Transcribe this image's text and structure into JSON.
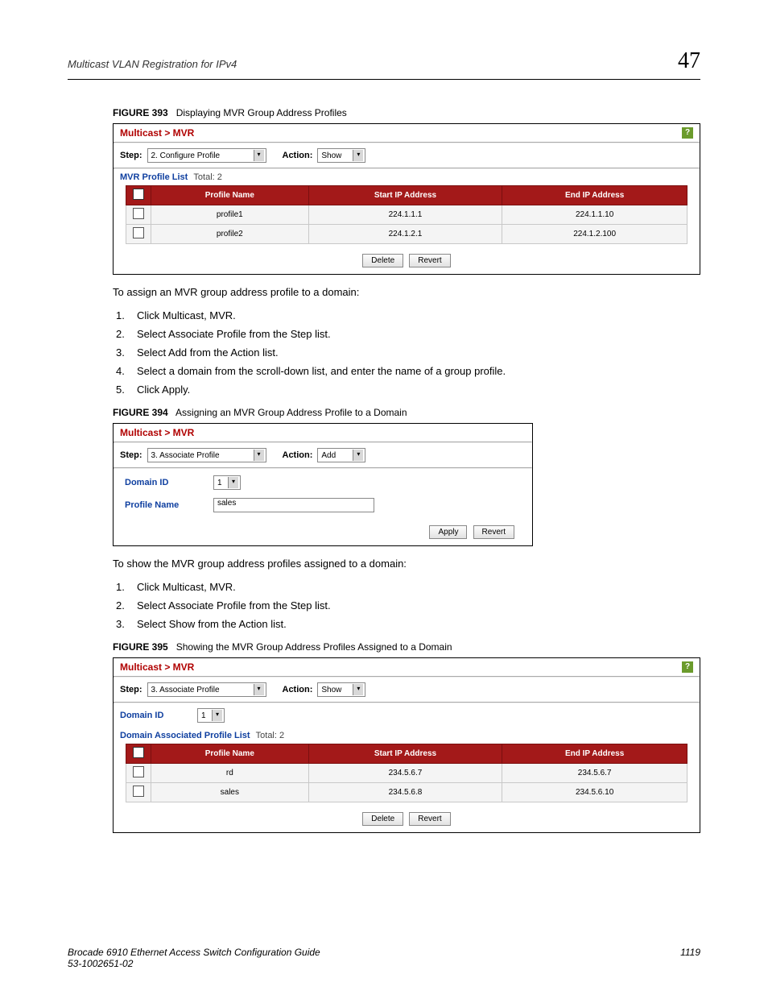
{
  "header": {
    "section_title": "Multicast VLAN Registration for IPv4",
    "chapter_number": "47"
  },
  "figure393": {
    "label": "FIGURE 393",
    "caption": "Displaying MVR Group Address Profiles",
    "breadcrumb": "Multicast > MVR",
    "step_label": "Step:",
    "step_value": "2. Configure Profile",
    "action_label": "Action:",
    "action_value": "Show",
    "list_title": "MVR Profile List",
    "list_total_label": "Total:",
    "list_total_value": "2",
    "columns": {
      "c1": "Profile Name",
      "c2": "Start IP Address",
      "c3": "End IP Address"
    },
    "rows": [
      {
        "name": "profile1",
        "start": "224.1.1.1",
        "end": "224.1.1.10"
      },
      {
        "name": "profile2",
        "start": "224.1.2.1",
        "end": "224.1.2.100"
      }
    ],
    "btn_delete": "Delete",
    "btn_revert": "Revert"
  },
  "assign_intro": "To assign an MVR group address profile to a domain:",
  "assign_steps": [
    "Click Multicast, MVR.",
    "Select Associate Profile from the Step list.",
    "Select Add from the Action list.",
    "Select a domain from the scroll-down list, and enter the name of a group profile.",
    "Click Apply."
  ],
  "figure394": {
    "label": "FIGURE 394",
    "caption": "Assigning an MVR Group Address Profile to a Domain",
    "breadcrumb": "Multicast > MVR",
    "step_label": "Step:",
    "step_value": "3. Associate Profile",
    "action_label": "Action:",
    "action_value": "Add",
    "domain_id_label": "Domain ID",
    "domain_id_value": "1",
    "profile_name_label": "Profile Name",
    "profile_name_value": "sales",
    "btn_apply": "Apply",
    "btn_revert": "Revert"
  },
  "show_intro": "To show the MVR group address profiles assigned to a domain:",
  "show_steps": [
    "Click Multicast, MVR.",
    "Select Associate Profile from the Step list.",
    "Select Show from the Action list."
  ],
  "figure395": {
    "label": "FIGURE 395",
    "caption": "Showing the MVR Group Address Profiles Assigned to a Domain",
    "breadcrumb": "Multicast > MVR",
    "step_label": "Step:",
    "step_value": "3. Associate Profile",
    "action_label": "Action:",
    "action_value": "Show",
    "domain_id_label": "Domain ID",
    "domain_id_value": "1",
    "list_title": "Domain Associated Profile List",
    "list_total_label": "Total:",
    "list_total_value": "2",
    "columns": {
      "c1": "Profile Name",
      "c2": "Start IP Address",
      "c3": "End IP Address"
    },
    "rows": [
      {
        "name": "rd",
        "start": "234.5.6.7",
        "end": "234.5.6.7"
      },
      {
        "name": "sales",
        "start": "234.5.6.8",
        "end": "234.5.6.10"
      }
    ],
    "btn_delete": "Delete",
    "btn_revert": "Revert"
  },
  "footer": {
    "line1": "Brocade 6910 Ethernet Access Switch Configuration Guide",
    "line2": "53-1002651-02",
    "page_number": "1119"
  },
  "icons": {
    "help": "?",
    "caret": "▾"
  }
}
